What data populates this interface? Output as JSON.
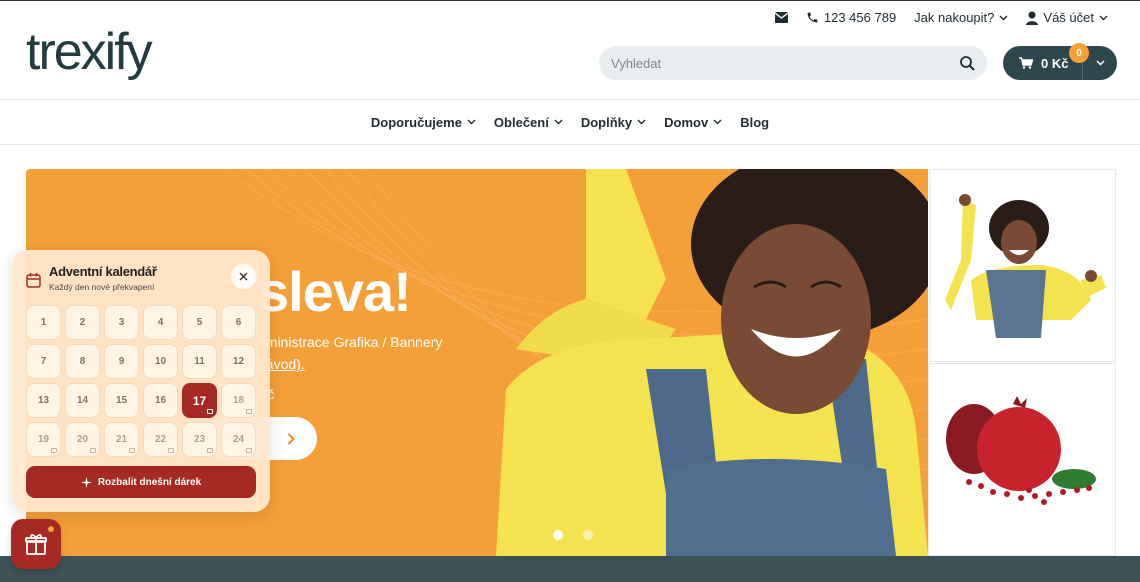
{
  "header": {
    "logo": "trexify",
    "phone": "123 456 789",
    "how_to_buy": "Jak nakoupit?",
    "account": "Váš účet",
    "search_placeholder": "Vyhledat",
    "cart_total": "0 Kč",
    "cart_count": "0"
  },
  "nav": {
    "items": [
      {
        "label": "Doporučujeme"
      },
      {
        "label": "Oblečení"
      },
      {
        "label": "Doplňky"
      },
      {
        "label": "Domov"
      },
      {
        "label": "Blog"
      }
    ]
  },
  "hero": {
    "title": "sleva!",
    "subtitle_1": "dministrace Grafika / Bannery",
    "subtitle_2": "návod).",
    "price": "Kč",
    "slides_total": 2,
    "active_slide": 1
  },
  "advent": {
    "title": "Adventní kalendář",
    "subtitle": "Každý den nové překvapení",
    "today": "17",
    "days": [
      "1",
      "2",
      "3",
      "4",
      "5",
      "6",
      "7",
      "8",
      "9",
      "10",
      "11",
      "12",
      "13",
      "14",
      "15",
      "16",
      "17",
      "18",
      "19",
      "20",
      "21",
      "22",
      "23",
      "24"
    ],
    "unwrap_label": "Rozbalit dnešní dárek"
  },
  "colors": {
    "brand": "#2d474d",
    "accent": "#f59f38",
    "advent_red": "#a52a23",
    "badge": "#f7a033"
  }
}
